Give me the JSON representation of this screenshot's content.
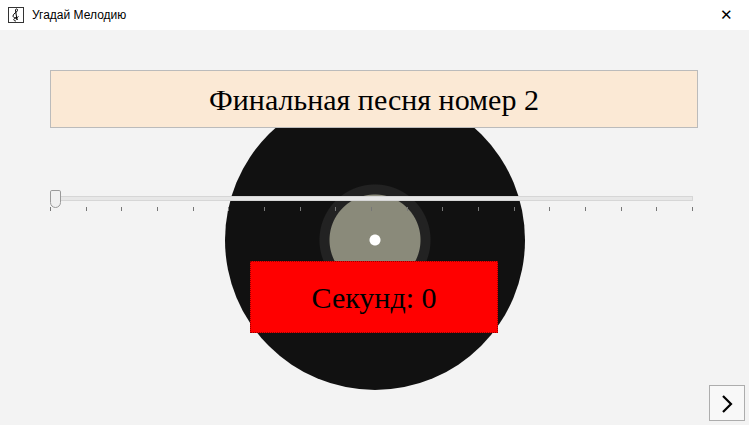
{
  "window": {
    "title": "Угадай Мелодию",
    "close": "✕"
  },
  "heading": "Финальная песня номер 2",
  "slider": {
    "level": 0
  },
  "timer": "Секунд: 0"
}
